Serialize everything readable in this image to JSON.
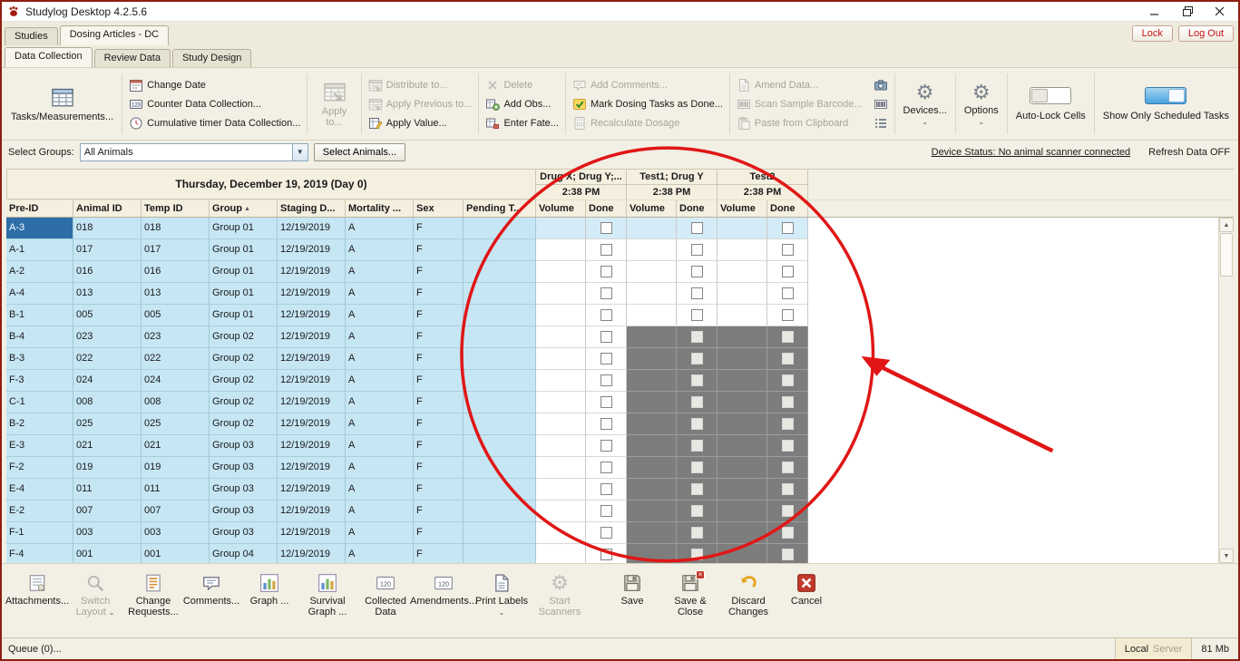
{
  "window": {
    "title": "Studylog Desktop 4.2.5.6"
  },
  "colors": {
    "selection": "#2d6ea8",
    "row_highlight": "#c6e6f4",
    "locked_cell": "#7d7d7d",
    "annotation": "#e01616",
    "toggle_on": "#4aa3e0",
    "danger_text": "#c41414"
  },
  "header_tabs": {
    "tabs": [
      {
        "label": "Studies"
      },
      {
        "label": "Dosing Articles - DC"
      }
    ],
    "lock_button": "Lock",
    "logout_button": "Log Out"
  },
  "view_tabs": [
    {
      "label": "Data Collection"
    },
    {
      "label": "Review Data"
    },
    {
      "label": "Study Design"
    }
  ],
  "toolbar": {
    "tasks_measurements": "Tasks/Measurements...",
    "change_date": "Change Date",
    "counter_data_collection": "Counter Data Collection...",
    "cumulative_timer": "Cumulative timer Data Collection...",
    "apply_to": "Apply to...",
    "distribute_to": "Distribute to...",
    "apply_previous_to": "Apply Previous to...",
    "apply_value": "Apply Value...",
    "delete": "Delete",
    "add_obs": "Add Obs...",
    "enter_fate": "Enter Fate...",
    "add_comments": "Add Comments...",
    "mark_dosing_done": "Mark Dosing Tasks as Done...",
    "recalculate_dosage": "Recalculate Dosage",
    "amend_data": "Amend Data...",
    "scan_sample_barcode": "Scan Sample Barcode...",
    "paste_from_clipboard": "Paste from Clipboard",
    "devices": "Devices...",
    "options": "Options",
    "auto_lock_cells": "Auto-Lock Cells",
    "show_only_scheduled": "Show Only Scheduled Tasks"
  },
  "filter_bar": {
    "select_groups_label": "Select Groups:",
    "groups_value": "All Animals",
    "select_animals_button": "Select Animals...",
    "device_status": "Device Status: No animal scanner connected",
    "refresh_status": "Refresh Data OFF"
  },
  "table": {
    "date_header": "Thursday, December 19, 2019 (Day 0)",
    "drug_groups": [
      {
        "name": "Drug X; Drug Y;...",
        "time": "2:38 PM"
      },
      {
        "name": "Test1; Drug Y",
        "time": "2:38 PM"
      },
      {
        "name": "Test2",
        "time": "2:38 PM"
      }
    ],
    "columns": [
      "Pre-ID",
      "Animal ID",
      "Temp ID",
      "Group",
      "Staging D...",
      "Mortality ...",
      "Sex",
      "Pending T..."
    ],
    "task_columns": [
      "Volume",
      "Done"
    ],
    "rows": [
      {
        "pre_id": "A-3",
        "animal_id": "018",
        "temp_id": "018",
        "group": "Group 01",
        "staging_date": "12/19/2019",
        "mortality": "A",
        "sex": "F",
        "pending": "",
        "selected": true,
        "locked": false
      },
      {
        "pre_id": "A-1",
        "animal_id": "017",
        "temp_id": "017",
        "group": "Group 01",
        "staging_date": "12/19/2019",
        "mortality": "A",
        "sex": "F",
        "pending": "",
        "selected": false,
        "locked": false
      },
      {
        "pre_id": "A-2",
        "animal_id": "016",
        "temp_id": "016",
        "group": "Group 01",
        "staging_date": "12/19/2019",
        "mortality": "A",
        "sex": "F",
        "pending": "",
        "selected": false,
        "locked": false
      },
      {
        "pre_id": "A-4",
        "animal_id": "013",
        "temp_id": "013",
        "group": "Group 01",
        "staging_date": "12/19/2019",
        "mortality": "A",
        "sex": "F",
        "pending": "",
        "selected": false,
        "locked": false
      },
      {
        "pre_id": "B-1",
        "animal_id": "005",
        "temp_id": "005",
        "group": "Group 01",
        "staging_date": "12/19/2019",
        "mortality": "A",
        "sex": "F",
        "pending": "",
        "selected": false,
        "locked": false
      },
      {
        "pre_id": "B-4",
        "animal_id": "023",
        "temp_id": "023",
        "group": "Group 02",
        "staging_date": "12/19/2019",
        "mortality": "A",
        "sex": "F",
        "pending": "",
        "selected": false,
        "locked": true
      },
      {
        "pre_id": "B-3",
        "animal_id": "022",
        "temp_id": "022",
        "group": "Group 02",
        "staging_date": "12/19/2019",
        "mortality": "A",
        "sex": "F",
        "pending": "",
        "selected": false,
        "locked": true
      },
      {
        "pre_id": "F-3",
        "animal_id": "024",
        "temp_id": "024",
        "group": "Group 02",
        "staging_date": "12/19/2019",
        "mortality": "A",
        "sex": "F",
        "pending": "",
        "selected": false,
        "locked": true
      },
      {
        "pre_id": "C-1",
        "animal_id": "008",
        "temp_id": "008",
        "group": "Group 02",
        "staging_date": "12/19/2019",
        "mortality": "A",
        "sex": "F",
        "pending": "",
        "selected": false,
        "locked": true
      },
      {
        "pre_id": "B-2",
        "animal_id": "025",
        "temp_id": "025",
        "group": "Group 02",
        "staging_date": "12/19/2019",
        "mortality": "A",
        "sex": "F",
        "pending": "",
        "selected": false,
        "locked": true
      },
      {
        "pre_id": "E-3",
        "animal_id": "021",
        "temp_id": "021",
        "group": "Group 03",
        "staging_date": "12/19/2019",
        "mortality": "A",
        "sex": "F",
        "pending": "",
        "selected": false,
        "locked": true
      },
      {
        "pre_id": "F-2",
        "animal_id": "019",
        "temp_id": "019",
        "group": "Group 03",
        "staging_date": "12/19/2019",
        "mortality": "A",
        "sex": "F",
        "pending": "",
        "selected": false,
        "locked": true
      },
      {
        "pre_id": "E-4",
        "animal_id": "011",
        "temp_id": "011",
        "group": "Group 03",
        "staging_date": "12/19/2019",
        "mortality": "A",
        "sex": "F",
        "pending": "",
        "selected": false,
        "locked": true
      },
      {
        "pre_id": "E-2",
        "animal_id": "007",
        "temp_id": "007",
        "group": "Group 03",
        "staging_date": "12/19/2019",
        "mortality": "A",
        "sex": "F",
        "pending": "",
        "selected": false,
        "locked": true
      },
      {
        "pre_id": "F-1",
        "animal_id": "003",
        "temp_id": "003",
        "group": "Group 03",
        "staging_date": "12/19/2019",
        "mortality": "A",
        "sex": "F",
        "pending": "",
        "selected": false,
        "locked": true
      },
      {
        "pre_id": "F-4",
        "animal_id": "001",
        "temp_id": "001",
        "group": "Group 04",
        "staging_date": "12/19/2019",
        "mortality": "A",
        "sex": "F",
        "pending": "",
        "selected": false,
        "locked": true
      }
    ]
  },
  "bottom_toolbar": {
    "items": [
      {
        "label": "Attachments...",
        "disabled": false
      },
      {
        "label": "Switch Layout",
        "disabled": true
      },
      {
        "label": "Change Requests...",
        "disabled": false
      },
      {
        "label": "Comments...",
        "disabled": false
      },
      {
        "label": "Graph ...",
        "disabled": false
      },
      {
        "label": "Survival Graph ...",
        "disabled": false
      },
      {
        "label": "Collected Data",
        "disabled": false
      },
      {
        "label": "Amendments...",
        "disabled": false
      },
      {
        "label": "Print Labels",
        "disabled": false
      },
      {
        "label": "Start Scanners",
        "disabled": true
      },
      {
        "label": "Save",
        "disabled": false
      },
      {
        "label": "Save & Close",
        "disabled": false
      },
      {
        "label": "Discard Changes",
        "disabled": false
      },
      {
        "label": "Cancel",
        "disabled": false
      }
    ]
  },
  "status_bar": {
    "queue": "Queue (0)...",
    "server_local": "Local",
    "server_remote": "Server",
    "memory": "81 Mb"
  }
}
